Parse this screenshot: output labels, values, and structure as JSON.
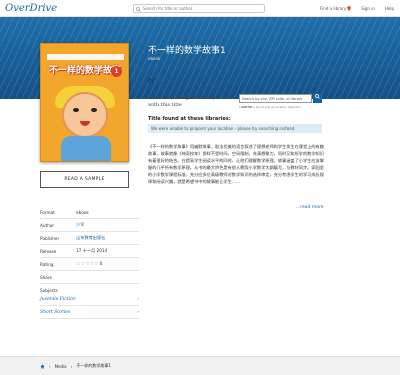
{
  "brand": {
    "name": "OverDrive"
  },
  "search": {
    "placeholder": "Search for title or author"
  },
  "nav": {
    "find_library": "Find a library",
    "sign_in": "Sign in",
    "help": "Help"
  },
  "book": {
    "title": "不一样的数学故事1",
    "format": "ebook",
    "by_prefix": "By",
    "author": "少军",
    "cover_title": "不一样的数学故事",
    "cover_badge": "1"
  },
  "library_search": {
    "prompt": "Search for a digital library with this title",
    "input_placeholder": "Search by city, ZIP code, or library name",
    "button_icon": "search-icon",
    "note": "Learn more about precise location detection",
    "found_title": "Title found at these libraries:",
    "alert": "We were unable to pinpoint your location - please try searching instead."
  },
  "description": {
    "text": "《不一样的数学故事》用幽默故事，取法优美的语言叙述了理想老师和学生发生在课堂上的有趣故事，故事就像《神奇校车》那样不受时间，空间限制，充满想象力，同时又和所学的数学知识有着很好的结合。在提高学生阅读水平的同时，让他们理解数学原理。故事涵盖了小学生应该掌握的几乎所有数学原理。从书的最大特色是有很人教版小学数学大纲编写，与教材同步。家园里的小学数学课程标准，充分应多位高级教师对数学知识的选择审定，充分考虑学生的学习成长规律和阅读兴趣，就是希望书中的故事能让学生……",
    "read_more": "...read more"
  },
  "actions": {
    "read_sample": "READ A SAMPLE"
  },
  "details": [
    {
      "key": "Format",
      "value": "ebook"
    },
    {
      "key": "Author",
      "value": "少军"
    },
    {
      "key": "Publisher",
      "value": "山东教育出版社"
    },
    {
      "key": "Release",
      "value": "17 十一月 2014"
    },
    {
      "key": "Rating",
      "stars_filled": 0,
      "stars_total": 5,
      "count": "0"
    },
    {
      "key": "Share",
      "value": ""
    }
  ],
  "subjects": {
    "heading": "Subjects",
    "items": [
      "Juvenile Fiction",
      "Short Stories"
    ]
  },
  "breadcrumb": {
    "home_icon": "home-icon",
    "media": "Media",
    "current": "不一样的数学故事1"
  },
  "colors": {
    "accent": "#1565a9",
    "hero": "#1a5f99",
    "cover": "#f3a62c"
  }
}
